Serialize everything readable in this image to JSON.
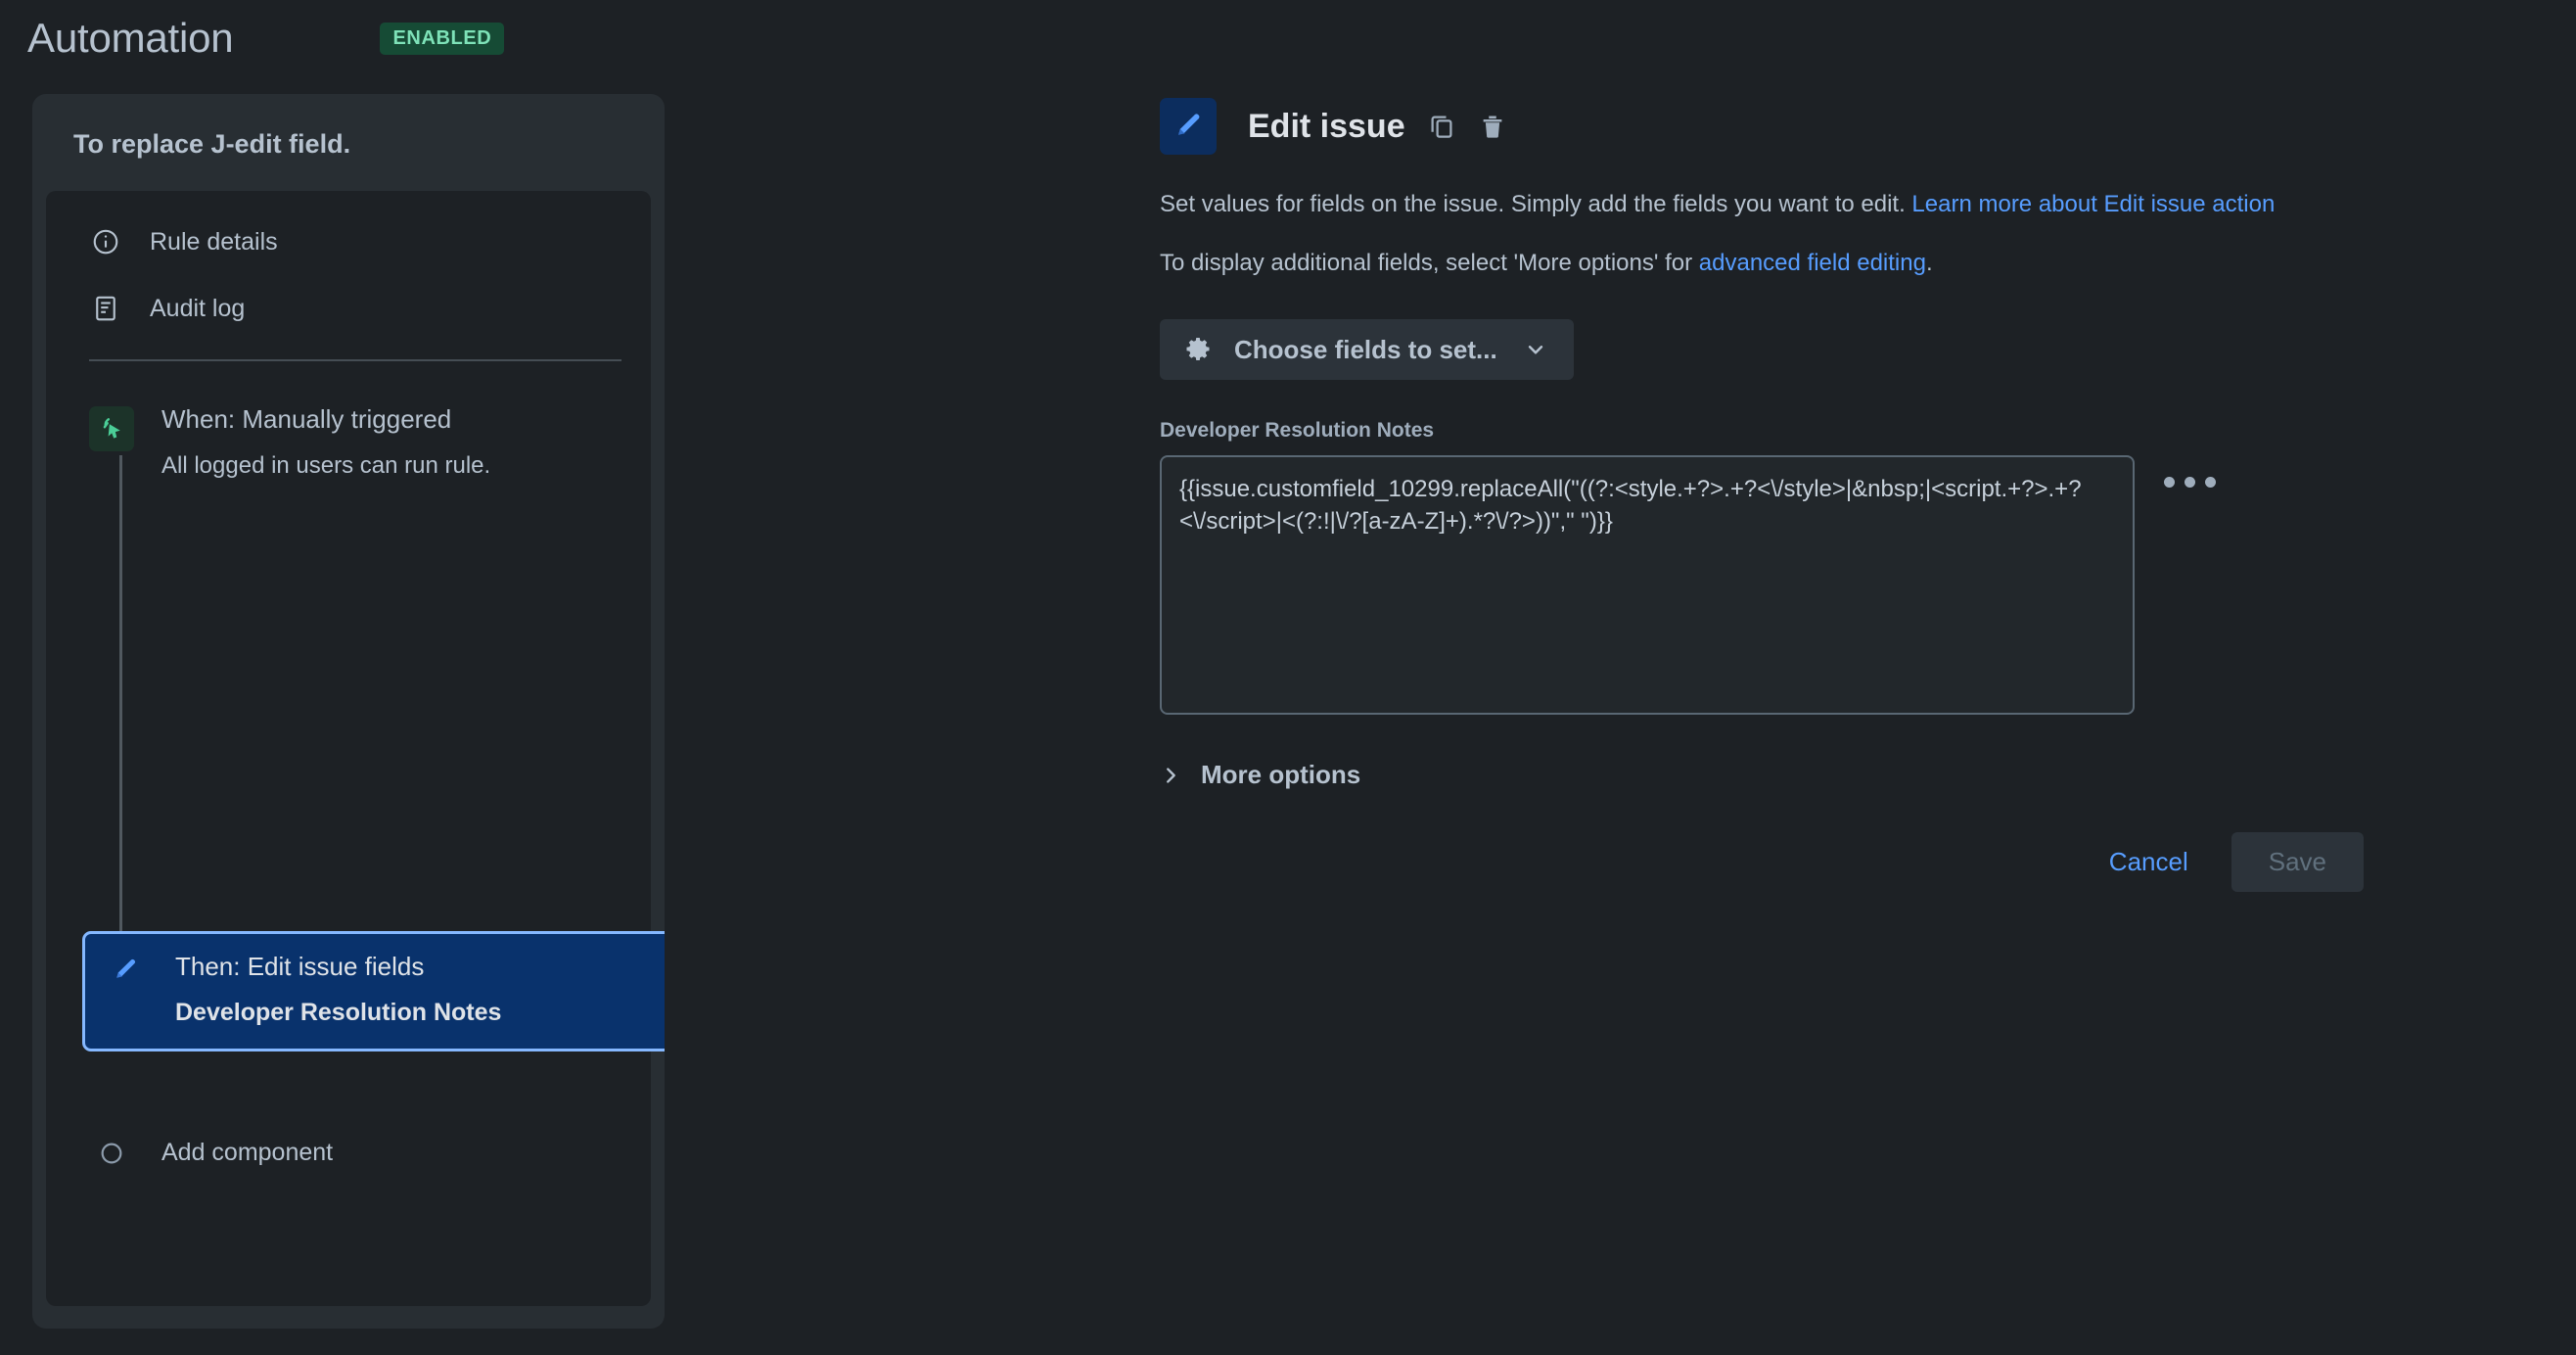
{
  "header": {
    "title": "Automation",
    "status_badge": "ENABLED"
  },
  "rule_panel": {
    "title": "To replace J-edit field.",
    "nav_items": [
      {
        "label": "Rule details",
        "icon": "info-circle-icon"
      },
      {
        "label": "Audit log",
        "icon": "document-list-icon"
      }
    ],
    "trigger": {
      "title": "When: Manually triggered",
      "subtitle": "All logged in users can run rule.",
      "icon": "cursor-click-icon"
    },
    "action": {
      "title": "Then: Edit issue fields",
      "subtitle": "Developer Resolution Notes",
      "icon": "pencil-icon"
    },
    "add_component": {
      "label": "Add component",
      "icon": "circle-outline-icon"
    }
  },
  "detail": {
    "title": "Edit issue",
    "icon": "pencil-icon",
    "copy_icon": "copy-icon",
    "delete_icon": "trash-icon",
    "description_1_pre": "Set values for fields on the issue. Simply add the fields you want to edit. ",
    "description_1_link": "Learn more about Edit issue action",
    "description_2_pre": "To display additional fields, select 'More options' for ",
    "description_2_link": "advanced field editing",
    "description_2_post": ".",
    "choose_fields_button": "Choose fields to set...",
    "choose_fields_icon": "gear-icon",
    "choose_fields_chevron": "chevron-down-icon",
    "field": {
      "label": "Developer Resolution Notes",
      "value": "{{issue.customfield_10299.replaceAll(\"((?:<style.+?>.+?<\\/style>|&nbsp;|<script.+?>.+?<\\/script>|<(?:!|\\/?[a-zA-Z]+).*?\\/?>))\",\" \")}}",
      "overflow_menu_icon": "more-horizontal-icon"
    },
    "more_options": {
      "label": "More options",
      "icon": "chevron-right-icon"
    },
    "buttons": {
      "cancel": "Cancel",
      "save": "Save"
    }
  },
  "colors": {
    "page_bg": "#1d2125",
    "panel_bg": "#282e33",
    "panel_inner_bg": "#1d2125",
    "text": "#b6c2cf",
    "link": "#579dff",
    "badge_bg": "#164b35",
    "badge_text": "#7ee2b8",
    "selected_card_bg": "#09326c",
    "selected_card_border": "#85b8ff"
  }
}
